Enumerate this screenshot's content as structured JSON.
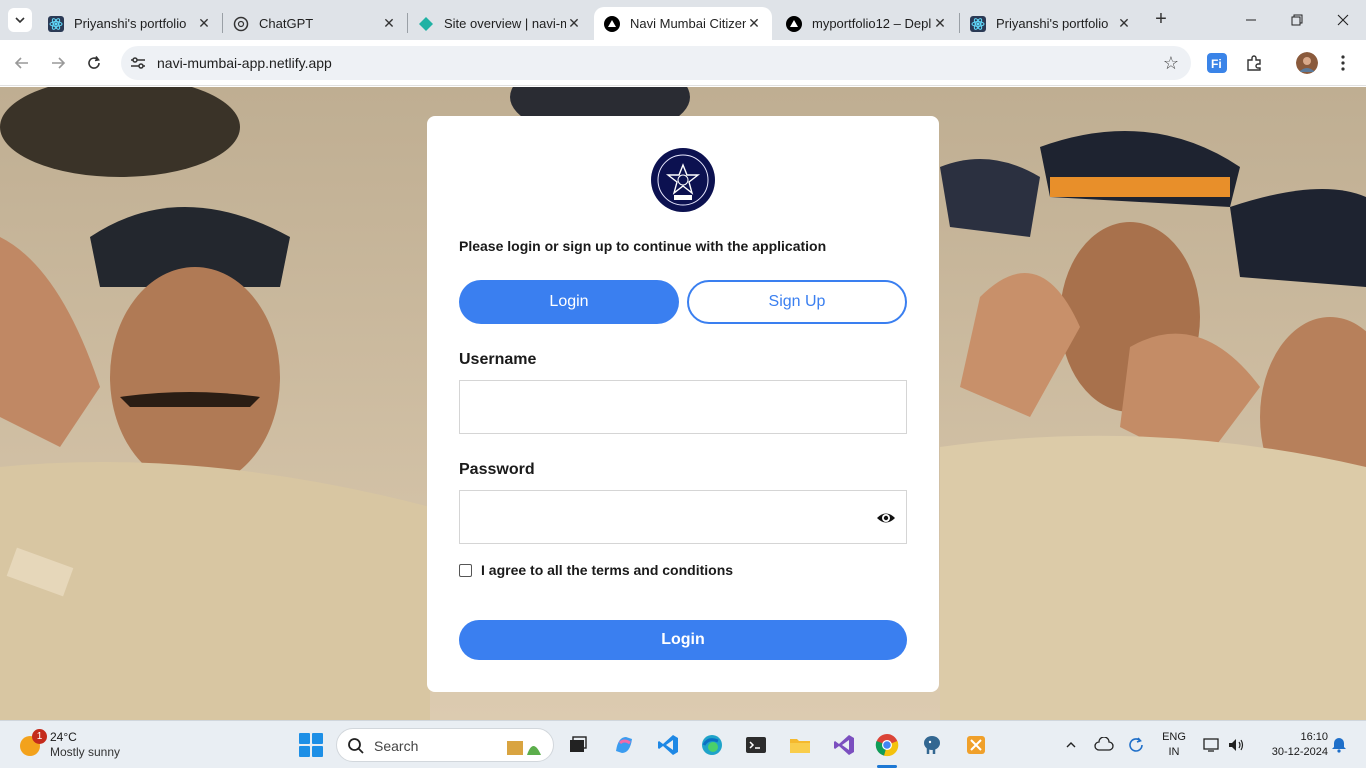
{
  "browser": {
    "tabs": [
      {
        "title": "Priyanshi's portfolio",
        "icon": "react-icon",
        "active": false
      },
      {
        "title": "ChatGPT",
        "icon": "chatgpt-icon",
        "active": false
      },
      {
        "title": "Site overview | navi-m",
        "icon": "netlify-icon",
        "active": false
      },
      {
        "title": "Navi Mumbai Citizen",
        "icon": "vercel-icon",
        "active": true
      },
      {
        "title": "myportfolio12 – Depl",
        "icon": "vercel-icon",
        "active": false
      },
      {
        "title": "Priyanshi's portfolio",
        "icon": "react-icon",
        "active": false
      }
    ],
    "new_tab": "+",
    "address": "navi-mumbai-app.netlify.app"
  },
  "page": {
    "intro_text": "Please login or sign up to continue with the application",
    "login_tab_label": "Login",
    "signup_tab_label": "Sign Up",
    "username_label": "Username",
    "username_value": "",
    "password_label": "Password",
    "password_value": "",
    "terms_label": "I agree to all the terms and conditions",
    "terms_checked": false,
    "submit_label": "Login",
    "accent_color": "#3a7ff0",
    "logo_color": "#0c1150"
  },
  "taskbar": {
    "weather_badge": "1",
    "weather_temp": "24°C",
    "weather_cond": "Mostly sunny",
    "search_placeholder": "Search",
    "lang_top": "ENG",
    "lang_bottom": "IN",
    "time": "16:10",
    "date": "30-12-2024"
  }
}
